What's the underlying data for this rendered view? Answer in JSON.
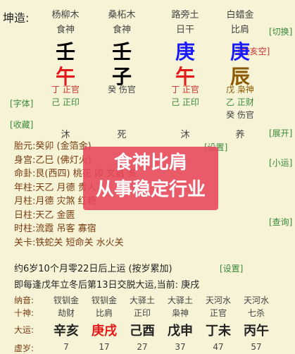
{
  "header": {
    "title": "坤造:",
    "switch_button": "[切换]",
    "xunkong": "[戌亥空]"
  },
  "pillars": [
    {
      "nayin": "杨柳木",
      "shishen": "食神",
      "gan": "壬",
      "gan_color": "#000000",
      "zhi": "午",
      "zhi_color": "#e31a1a",
      "hidden": [
        {
          "g": "丁",
          "s": "正官",
          "c": "#c33"
        },
        {
          "g": "己",
          "s": "正印",
          "c": "#3a8a3a"
        }
      ],
      "state": "沐"
    },
    {
      "nayin": "桑柘木",
      "shishen": "食神",
      "gan": "壬",
      "gan_color": "#000000",
      "zhi": "子",
      "zhi_color": "#000000",
      "hidden": [
        {
          "g": "癸",
          "s": "伤官",
          "c": "#444"
        }
      ],
      "state": "死"
    },
    {
      "nayin": "路旁土",
      "shishen": "日干",
      "gan": "庚",
      "gan_color": "#1a1aff",
      "zhi": "午",
      "zhi_color": "#e31a1a",
      "hidden": [
        {
          "g": "丁",
          "s": "正官",
          "c": "#c33"
        },
        {
          "g": "己",
          "s": "正印",
          "c": "#3a8a3a"
        }
      ],
      "state": "沐"
    },
    {
      "nayin": "白蜡金",
      "shishen": "比肩",
      "gan": "庚",
      "gan_color": "#1a1aff",
      "zhi": "辰",
      "zhi_color": "#8b5a00",
      "hidden": [
        {
          "g": "戊",
          "s": "枭神",
          "c": "#8b5a00"
        },
        {
          "g": "乙",
          "s": "正财",
          "c": "#3a8a3a"
        },
        {
          "g": "癸",
          "s": "伤官",
          "c": "#444"
        }
      ],
      "state": "养"
    }
  ],
  "side_buttons": {
    "font": "[字体]",
    "favorite": "[收藏]",
    "expand": "[展开]",
    "xiaoyun": "[小运]",
    "query": "[查询]",
    "settings1": "[设置]",
    "settings2": "[设置]"
  },
  "info_rows": [
    {
      "key": "胎元:",
      "value": "癸卯 (金箔金)"
    },
    {
      "key": "身宫:",
      "value": "乙巳 (佛灯火)"
    },
    {
      "key": "命卦:",
      "value": "艮(西四) 桃花  卯 文昌  亥"
    },
    {
      "key": "年柱:",
      "value": "天乙  月德  贵人"
    },
    {
      "key": "月柱:",
      "value": "月德  灾煞  红艳"
    },
    {
      "key": "日柱:",
      "value": "天乙  金匮"
    },
    {
      "key": "时柱:",
      "value": "流霞  吊客  寡宿"
    },
    {
      "key": "关卡:",
      "value": "铁蛇关  短命关  水火关"
    }
  ],
  "overlay": {
    "line1": "食神比肩",
    "line2": "从事稳定行业"
  },
  "qiyun": {
    "text": "约6岁10个月零22日后上运 (按岁累加)",
    "jiaoyun": "即每逢戊年立冬后第13日交脱大运,当前: 庚戌"
  },
  "dayun": {
    "labels": {
      "nayin": "纳音:",
      "shishen": "十神:",
      "dayun": "大运:",
      "age": "虚岁:"
    },
    "cols": [
      {
        "nayin": "钗钏金",
        "shishen": "劫财",
        "gz": "辛亥",
        "age": "7",
        "color": "#222"
      },
      {
        "nayin": "钗钏金",
        "shishen": "比肩",
        "gz": "庚戌",
        "age": "17",
        "color": "#e31a1a"
      },
      {
        "nayin": "大驿土",
        "shishen": "正印",
        "gz": "己酉",
        "age": "27",
        "color": "#222"
      },
      {
        "nayin": "大驿土",
        "shishen": "枭神",
        "gz": "戊申",
        "age": "37",
        "color": "#222"
      },
      {
        "nayin": "天河水",
        "shishen": "正官",
        "gz": "丁未",
        "age": "47",
        "color": "#222"
      },
      {
        "nayin": "天河水",
        "shishen": "七杀",
        "gz": "丙午",
        "age": "57",
        "color": "#222"
      }
    ]
  }
}
